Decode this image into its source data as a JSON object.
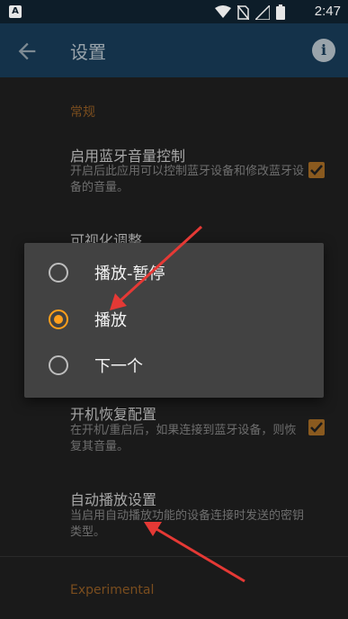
{
  "status_bar": {
    "time": "2:47",
    "icons": [
      "app-notification-icon",
      "wifi-icon",
      "no-sim-icon",
      "signal-icon",
      "battery-icon"
    ]
  },
  "app_bar": {
    "title": "设置",
    "back_icon": "back-arrow-icon",
    "info_icon": "info-icon"
  },
  "sections": {
    "general_header": "常规",
    "experimental_header": "Experimental"
  },
  "preferences": {
    "bt_volume": {
      "title": "启用蓝牙音量控制",
      "summary": "开启后此应用可以控制蓝牙设备和修改蓝牙设备的音量。",
      "checked": true
    },
    "visual": {
      "title": "可视化调整"
    },
    "restore": {
      "title": "开机恢复配置",
      "summary": "在开机/重启后，如果连接到蓝牙设备，则恢复其音量。",
      "checked": true
    },
    "autoplay": {
      "title": "自动播放设置",
      "summary": "当启用自动播放功能的设备连接时发送的密钥类型。"
    }
  },
  "dialog": {
    "options": [
      {
        "label": "播放-暂停",
        "selected": false
      },
      {
        "label": "播放",
        "selected": true
      },
      {
        "label": "下一个",
        "selected": false
      }
    ]
  },
  "colors": {
    "accent": "#ff9f1c",
    "app_bar": "#14324a",
    "annotation_arrow": "#e53935"
  }
}
